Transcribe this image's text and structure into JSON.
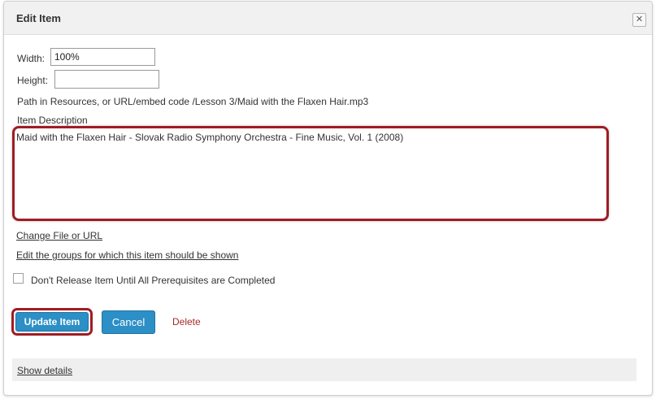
{
  "dialog": {
    "title": "Edit Item",
    "close_icon": "close-icon"
  },
  "form": {
    "width_label": "Width:",
    "width_value": "100%",
    "height_label": "Height:",
    "height_value": "",
    "path_text": "Path in Resources, or URL/embed code /Lesson 3/Maid with the Flaxen Hair.mp3",
    "description_label": "Item Description",
    "description_value": "Maid with the Flaxen Hair - Slovak Radio Symphony Orchestra - Fine Music, Vol. 1 (2008)"
  },
  "links": {
    "change_file": "Change File or URL",
    "edit_groups": "Edit the groups for which this item should be shown"
  },
  "prerequisite": {
    "label": "Don't Release Item Until All Prerequisites are Completed",
    "checked": false
  },
  "actions": {
    "update": "Update Item",
    "cancel": "Cancel",
    "delete": "Delete"
  },
  "details": {
    "show_label": "Show details"
  },
  "colors": {
    "primary_button": "#2c8fc5",
    "highlight_border": "#a01c24",
    "delete_text": "#a52a2a"
  }
}
